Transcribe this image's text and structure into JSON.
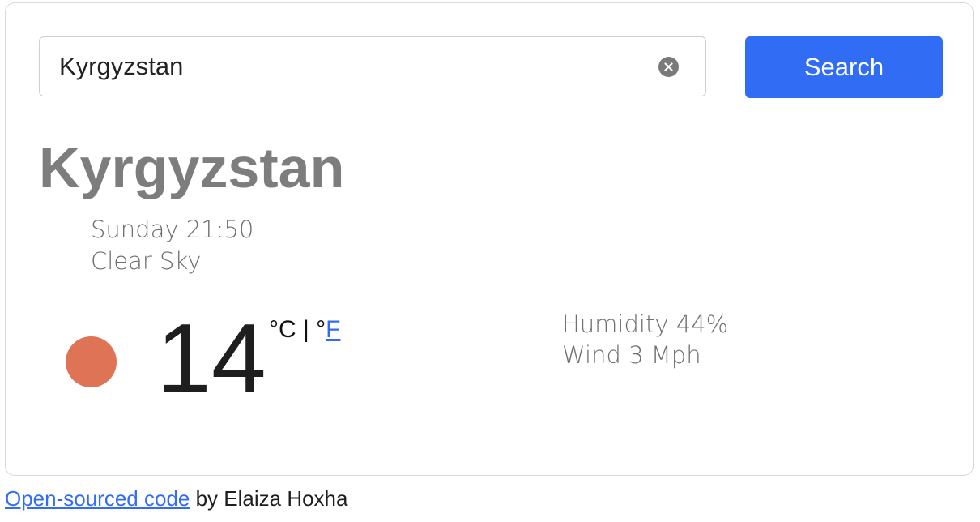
{
  "search": {
    "value": "Kyrgyzstan",
    "placeholder": "",
    "button_label": "Search"
  },
  "weather": {
    "city": "Kyrgyzstan",
    "datetime": "Sunday 21:50",
    "description": "Clear Sky",
    "temperature": "14",
    "unit_celsius": "°C",
    "unit_separator": " | ",
    "unit_fahrenheit_prefix": "°",
    "unit_fahrenheit_link": "F",
    "humidity": "Humidity 44%",
    "wind": "Wind 3 Mph",
    "icon": "clear-sky-icon"
  },
  "footer": {
    "link_text": "Open-sourced code",
    "author_text": " by Elaiza Hoxha"
  },
  "colors": {
    "accent": "#316cf4",
    "icon_sun": "#df7356",
    "title_gray": "#7d7d7d"
  },
  "icons": {
    "clear_input": "close-circle-icon",
    "weather": "sun-icon"
  }
}
